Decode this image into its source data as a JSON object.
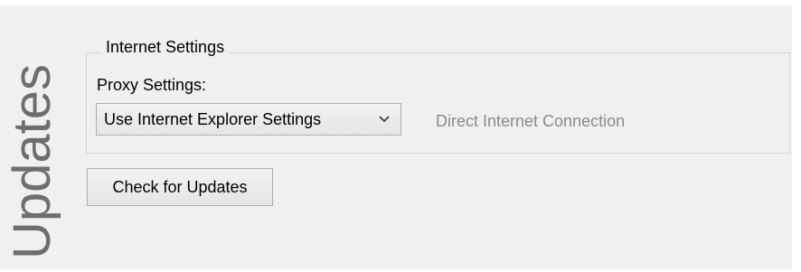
{
  "section": {
    "title": "Updates"
  },
  "internet_settings": {
    "group_title": "Internet Settings",
    "proxy_label": "Proxy Settings:",
    "proxy_select": {
      "selected": "Use Internet Explorer Settings",
      "icon": "chevron-down-icon"
    },
    "connection_status": "Direct Internet Connection"
  },
  "actions": {
    "check_updates_label": "Check for Updates"
  },
  "colors": {
    "panel_background": "#f0f0f0",
    "title_text": "#6e6e6e",
    "disabled_text": "#8a8a8a",
    "border": "#d5d5d5"
  }
}
